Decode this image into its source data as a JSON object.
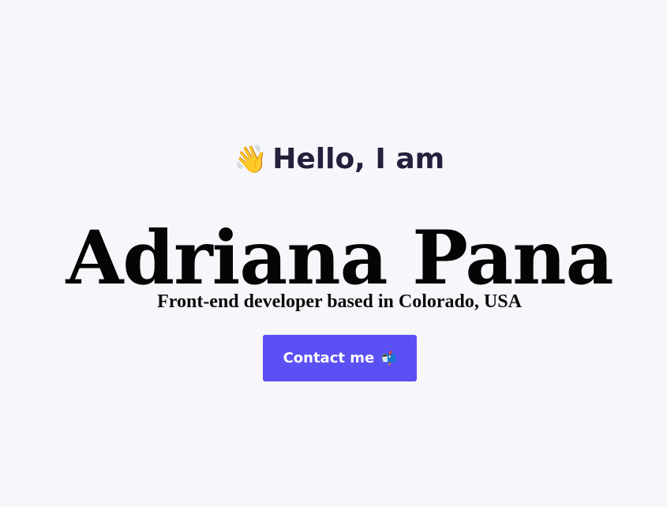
{
  "hero": {
    "wave_emoji": "👋",
    "greeting": "Hello, I am",
    "name": "Adriana Pana",
    "tagline": "Front-end developer based in Colorado, USA",
    "contact_button": {
      "label": "Contact me",
      "icon": "📬"
    }
  },
  "colors": {
    "background": "#f6f6fb",
    "greeting_text": "#22203a",
    "accent_button": "#5b50f3",
    "button_text": "#ffffff"
  }
}
